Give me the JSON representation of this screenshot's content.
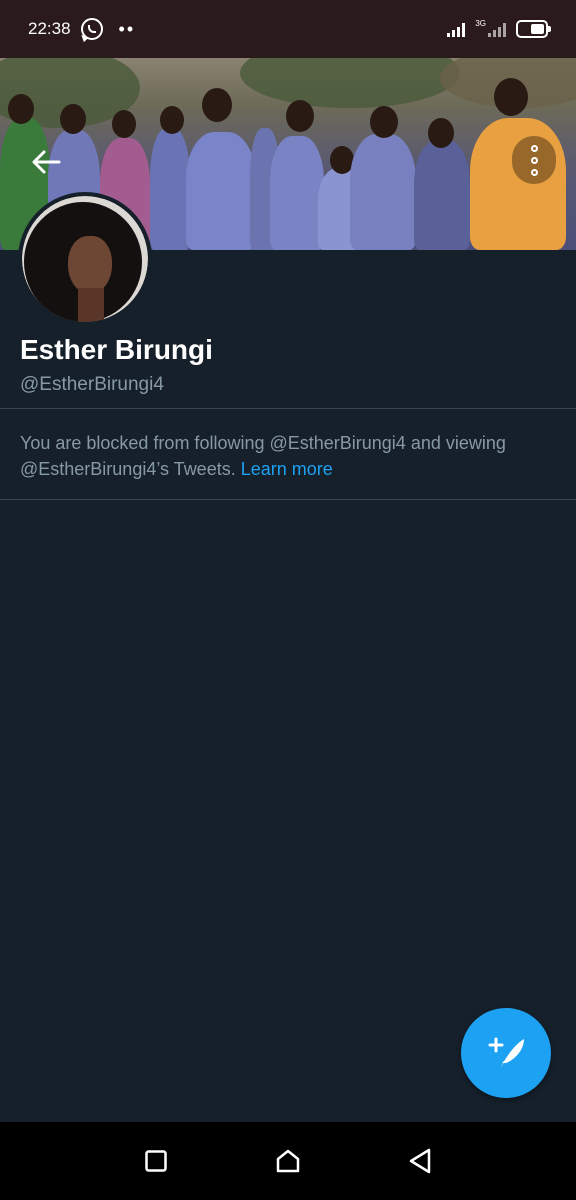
{
  "status_bar": {
    "time": "22:38",
    "notification_icon": "whatsapp-icon",
    "extra_dots": "••",
    "network_label": "3G",
    "battery_level": 0.55
  },
  "header": {
    "back_icon": "arrow-left-icon",
    "more_icon": "more-vertical-icon"
  },
  "profile": {
    "name": "Esther Birungi",
    "handle": "@EstherBirungi4"
  },
  "blocked_notice": {
    "text": "You are blocked from following @EstherBirungi4 and viewing @EstherBirungi4’s Tweets.",
    "link": "Learn more"
  },
  "fab": {
    "icon": "compose-tweet-icon"
  },
  "nav_bar": {
    "recents_icon": "square-icon",
    "home_icon": "home-icon",
    "back_icon": "triangle-back-icon"
  },
  "colors": {
    "background": "#15202b",
    "accent": "#1da1f2",
    "secondary_text": "#8899a6",
    "divider": "#38444d"
  }
}
